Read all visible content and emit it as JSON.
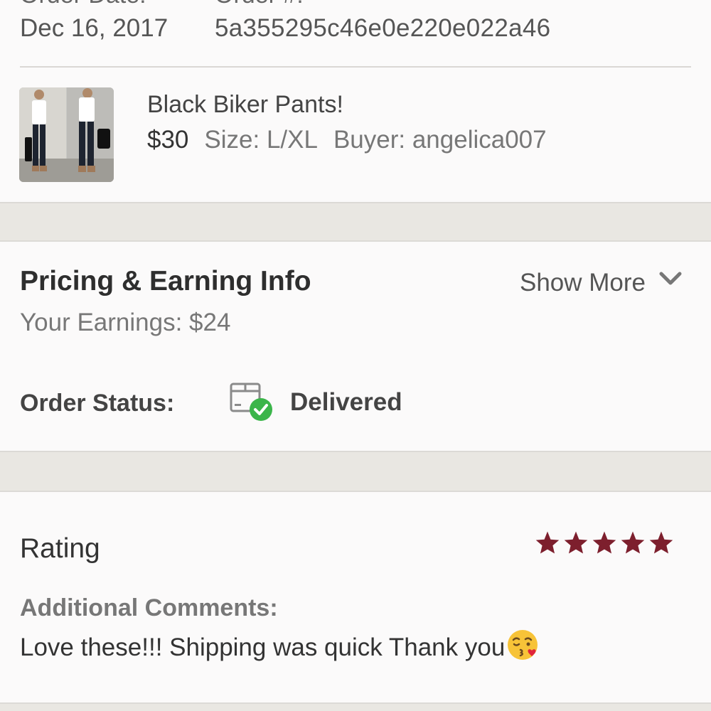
{
  "order": {
    "date_label": "Order Date:",
    "number_label": "Order #:",
    "date": "Dec 16, 2017",
    "number": "5a355295c46e0e220e022a46"
  },
  "item": {
    "title": "Black Biker Pants!",
    "price": "$30",
    "size": "Size: L/XL",
    "buyer": "Buyer: angelica007",
    "thumbnail_icon": "product-photo"
  },
  "pricing": {
    "title": "Pricing & Earning Info",
    "earnings": "Your Earnings: $24",
    "show_more": "Show More",
    "chevron_icon": "chevron-down-icon"
  },
  "status": {
    "label": "Order Status:",
    "value": "Delivered",
    "icon": "delivered-box-icon",
    "check_color": "#3bb54a"
  },
  "rating": {
    "title": "Rating",
    "stars": 5,
    "star_color": "#7d1f2d",
    "comments_label": "Additional Comments:",
    "comments": "Love these!!! Shipping was quick Thank you"
  }
}
